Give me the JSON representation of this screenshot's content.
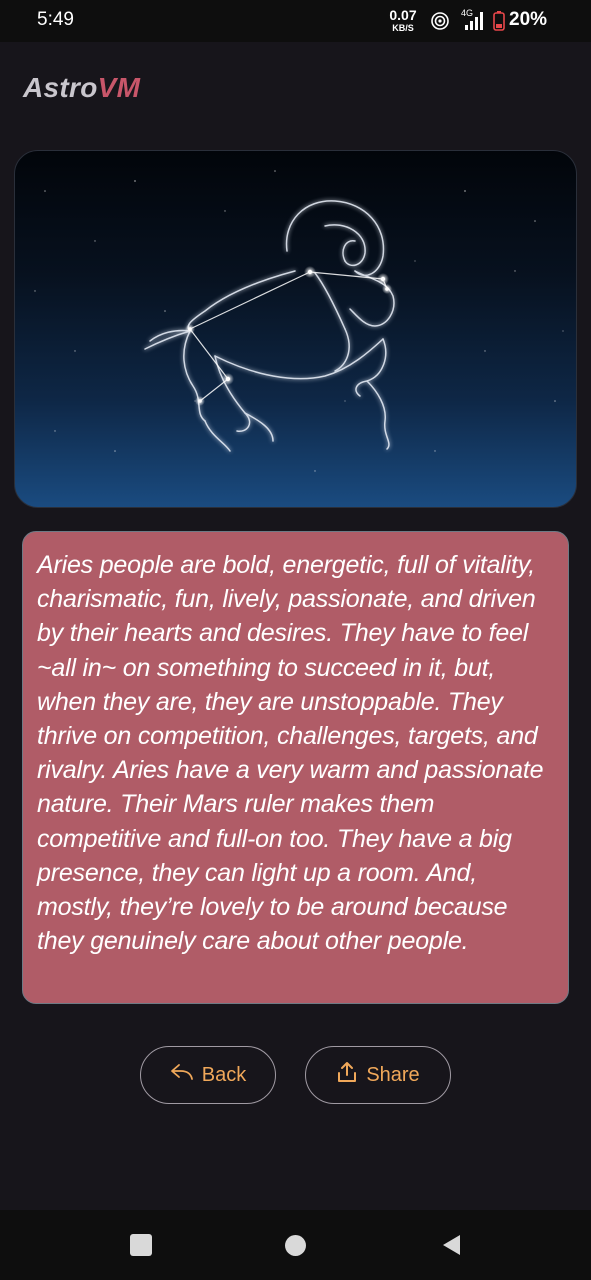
{
  "status_bar": {
    "time": "5:49",
    "net_speed_value": "0.07",
    "net_speed_unit": "KB/S",
    "network_type": "4G",
    "battery": "20%"
  },
  "app": {
    "title_part1": "Astro",
    "title_part2": "VM"
  },
  "hero": {
    "icon": "aries-constellation-image"
  },
  "description": "Aries people are bold, energetic, full of vitality, charismatic, fun, lively, passionate, and driven by their hearts and desires. They have to feel ~all in~ on something to succeed in it, but, when they are, they are unstoppable. They thrive on competition, challenges, targets, and rivalry. Aries have a very warm and passionate nature. Their Mars ruler makes them competitive and full-on too. They have a big presence, they can light up a room. And, mostly, they’re lovely to be around because they genuinely care about other people.",
  "actions": {
    "back_label": "Back",
    "share_label": "Share"
  },
  "colors": {
    "accent": "#f0a85a",
    "card": "#b05c67",
    "title_accent": "#c8566a",
    "background": "#17151b"
  }
}
